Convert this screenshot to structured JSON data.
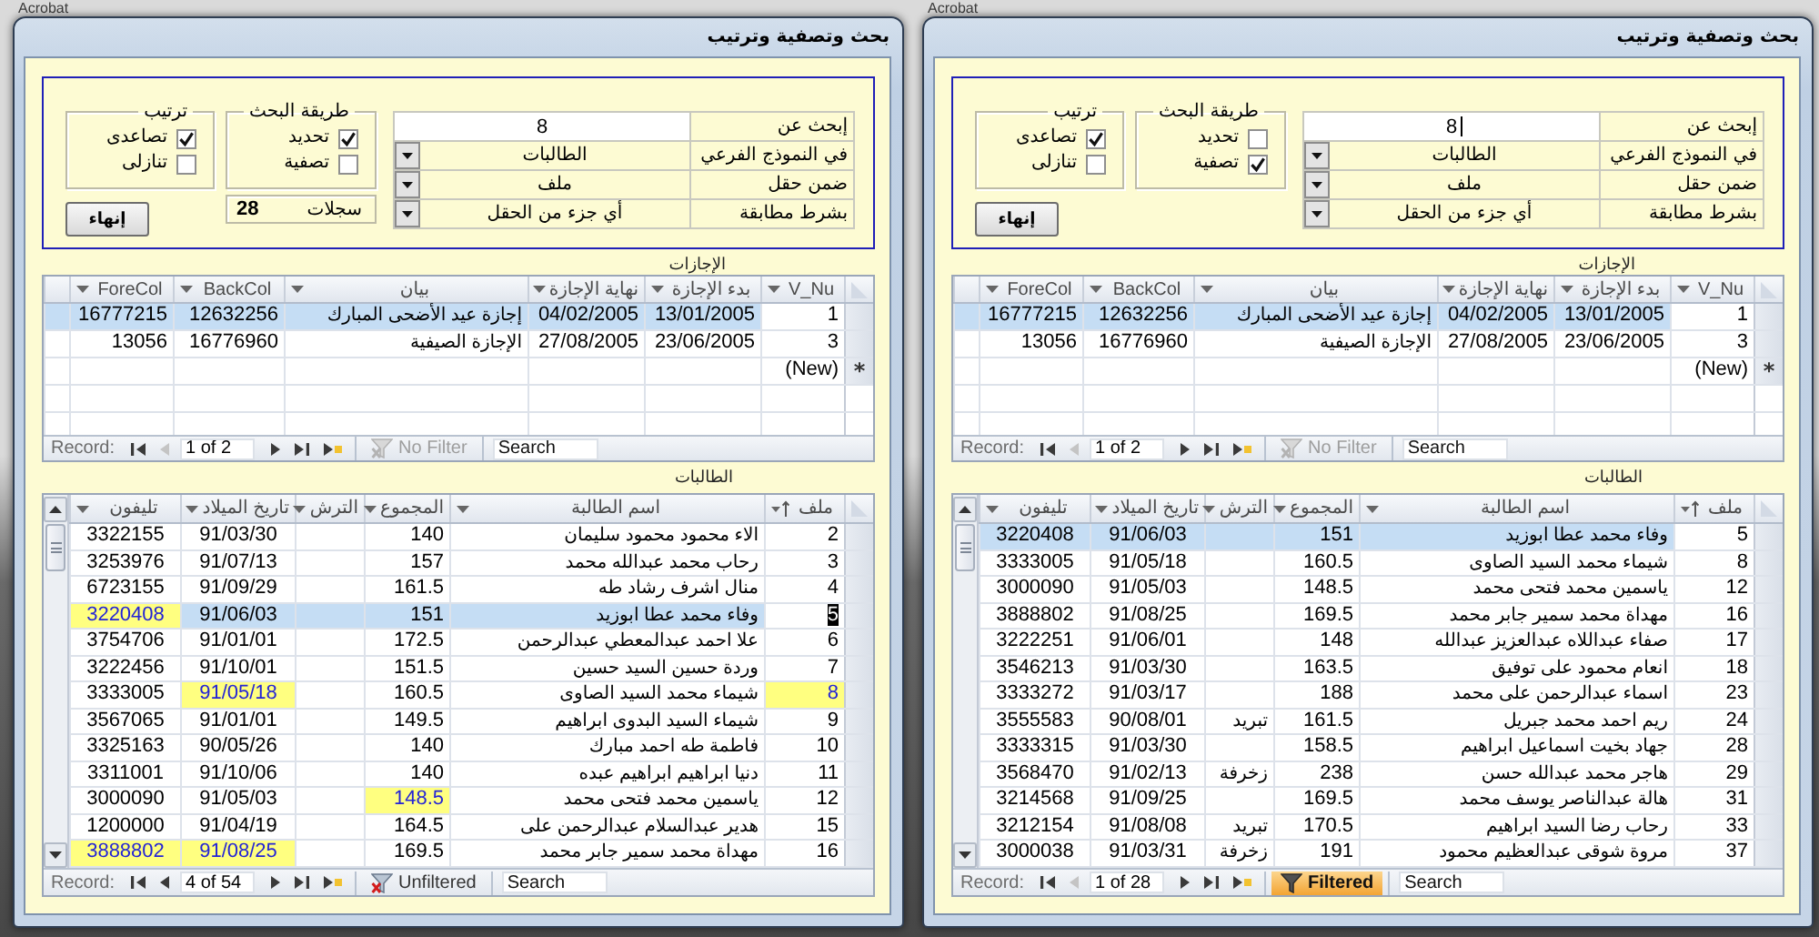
{
  "screens": [
    {
      "background_app": {
        "title": "Acrobat"
      },
      "window": {
        "title": "بحث وتصفية وترتيب"
      },
      "search_panel": {
        "fields": [
          {
            "kind": "text",
            "label": "إبحث عن",
            "value": "8",
            "focused": true
          },
          {
            "kind": "dropdown",
            "label": "في النموذج الفرعي",
            "value": "الطالبات"
          },
          {
            "kind": "dropdown",
            "label": "ضمن حقل",
            "value": "ملف"
          },
          {
            "kind": "dropdown",
            "label": "بشرط مطابقة",
            "value": "أي جزء من الحقل"
          }
        ],
        "search_method": {
          "title": "طريقة البحث",
          "options": [
            {
              "label": "تحديد",
              "checked": false
            },
            {
              "label": "تصفية",
              "checked": true
            }
          ]
        },
        "sort_order": {
          "title": "ترتيب",
          "options": [
            {
              "label": "تصاعدى",
              "checked": true
            },
            {
              "label": "تنازلى",
              "checked": false
            }
          ]
        },
        "close_button": {
          "label": "إنهاء"
        }
      },
      "leaves": {
        "title": "الإجازات",
        "columns": [
          "V_Nu",
          "بدء الإجازة",
          "نهاية الإجازة",
          "بيان",
          "BackCol",
          "ForeCol"
        ],
        "rows": [
          {
            "selected": true,
            "cells": [
              "1",
              "13/01/2005",
              "04/02/2005",
              "إجازة عيد الأضحى المبارك",
              "12632256",
              "16777215"
            ]
          },
          {
            "selected": false,
            "cells": [
              "3",
              "23/06/2005",
              "27/08/2005",
              "الإجازة الصيفية",
              "16776960",
              "13056"
            ]
          }
        ],
        "new_row": {
          "marker": "*",
          "text": "(New)"
        },
        "navigation": {
          "label": "Record:",
          "position": "1 of 2",
          "previous_enabled": false,
          "filter": {
            "label": "No Filter",
            "disabled": true,
            "active": false
          },
          "search": {
            "placeholder": "Search"
          }
        }
      },
      "students": {
        "title": "الطالبات",
        "columns": [
          {
            "label": "ملف",
            "sorted": true
          },
          {
            "label": "اسم الطالبة",
            "sorted": false
          },
          {
            "label": "المجموع",
            "sorted": false
          },
          {
            "label": "الترش",
            "sorted": false
          },
          {
            "label": "تاريخ الميلاد",
            "sorted": false
          },
          {
            "label": "تليفون",
            "sorted": false
          }
        ],
        "rows": [
          {
            "selected": true,
            "editing": false,
            "cells": [
              {
                "text": "5",
                "highlighted": false
              },
              {
                "text": "وفاء محمد عطا ابوزيد",
                "highlighted": false
              },
              {
                "text": "151",
                "highlighted": false
              },
              {
                "highlighted": false
              },
              {
                "text": "91/06/03",
                "highlighted": false
              },
              {
                "text": "3220408",
                "highlighted": false
              }
            ]
          },
          {
            "selected": false,
            "editing": false,
            "cells": [
              {
                "text": "8",
                "highlighted": false
              },
              {
                "text": "شيماء محمد السيد الصاوى",
                "highlighted": false
              },
              {
                "text": "160.5",
                "highlighted": false
              },
              {
                "highlighted": false
              },
              {
                "text": "91/05/18",
                "highlighted": false
              },
              {
                "text": "3333005",
                "highlighted": false
              }
            ]
          },
          {
            "selected": false,
            "editing": false,
            "cells": [
              {
                "text": "12",
                "highlighted": false
              },
              {
                "text": "ياسمين محمد فتحى محمد",
                "highlighted": false
              },
              {
                "text": "148.5",
                "highlighted": false
              },
              {
                "highlighted": false
              },
              {
                "text": "91/05/03",
                "highlighted": false
              },
              {
                "text": "3000090",
                "highlighted": false
              }
            ]
          },
          {
            "selected": false,
            "editing": false,
            "cells": [
              {
                "text": "16",
                "highlighted": false
              },
              {
                "text": "مهداة محمد سمير جابر محمد",
                "highlighted": false
              },
              {
                "text": "169.5",
                "highlighted": false
              },
              {
                "highlighted": false
              },
              {
                "text": "91/08/25",
                "highlighted": false
              },
              {
                "text": "3888802",
                "highlighted": false
              }
            ]
          },
          {
            "selected": false,
            "editing": false,
            "cells": [
              {
                "text": "17",
                "highlighted": false
              },
              {
                "text": "صفاء عبداللاه عبدالعزيز عبدالله",
                "highlighted": false
              },
              {
                "text": "148",
                "highlighted": false
              },
              {
                "highlighted": false
              },
              {
                "text": "91/06/01",
                "highlighted": false
              },
              {
                "text": "3222251",
                "highlighted": false
              }
            ]
          },
          {
            "selected": false,
            "editing": false,
            "cells": [
              {
                "text": "18",
                "highlighted": false
              },
              {
                "text": "انعام محمود على توفيق",
                "highlighted": false
              },
              {
                "text": "163.5",
                "highlighted": false
              },
              {
                "highlighted": false
              },
              {
                "text": "91/03/30",
                "highlighted": false
              },
              {
                "text": "3546213",
                "highlighted": false
              }
            ]
          },
          {
            "selected": false,
            "editing": false,
            "cells": [
              {
                "text": "23",
                "highlighted": false
              },
              {
                "text": "اسماء عبدالرحمن على محمد",
                "highlighted": false
              },
              {
                "text": "188",
                "highlighted": false
              },
              {
                "highlighted": false
              },
              {
                "text": "91/03/17",
                "highlighted": false
              },
              {
                "text": "3333272",
                "highlighted": false
              }
            ]
          },
          {
            "selected": false,
            "editing": false,
            "cells": [
              {
                "text": "24",
                "highlighted": false
              },
              {
                "text": "ريم احمد محمد جبريل",
                "highlighted": false
              },
              {
                "text": "161.5",
                "highlighted": false
              },
              {
                "text": "تبريد",
                "highlighted": false
              },
              {
                "text": "90/08/01",
                "highlighted": false
              },
              {
                "text": "3555583",
                "highlighted": false
              }
            ]
          },
          {
            "selected": false,
            "editing": false,
            "cells": [
              {
                "text": "28",
                "highlighted": false
              },
              {
                "text": "جهاد بخيت اسماعيل ابراهيم",
                "highlighted": false
              },
              {
                "text": "158.5",
                "highlighted": false
              },
              {
                "highlighted": false
              },
              {
                "text": "91/03/30",
                "highlighted": false
              },
              {
                "text": "3333315",
                "highlighted": false
              }
            ]
          },
          {
            "selected": false,
            "editing": false,
            "cells": [
              {
                "text": "29",
                "highlighted": false
              },
              {
                "text": "هاجر محمد عبدالله حسن",
                "highlighted": false
              },
              {
                "text": "238",
                "highlighted": false
              },
              {
                "text": "زخرفة",
                "highlighted": false
              },
              {
                "text": "91/02/13",
                "highlighted": false
              },
              {
                "text": "3568470",
                "highlighted": false
              }
            ]
          },
          {
            "selected": false,
            "editing": false,
            "cells": [
              {
                "text": "31",
                "highlighted": false
              },
              {
                "text": "هالة عبدالناصر يوسف محمد",
                "highlighted": false
              },
              {
                "text": "169.5",
                "highlighted": false
              },
              {
                "highlighted": false
              },
              {
                "text": "91/09/25",
                "highlighted": false
              },
              {
                "text": "3214568",
                "highlighted": false
              }
            ]
          },
          {
            "selected": false,
            "editing": false,
            "cells": [
              {
                "text": "33",
                "highlighted": false
              },
              {
                "text": "رحاب رضا السيد ابراهيم",
                "highlighted": false
              },
              {
                "text": "170.5",
                "highlighted": false
              },
              {
                "text": "تبريد",
                "highlighted": false
              },
              {
                "text": "91/08/08",
                "highlighted": false
              },
              {
                "text": "3212154",
                "highlighted": false
              }
            ]
          },
          {
            "selected": false,
            "editing": false,
            "cells": [
              {
                "text": "37",
                "highlighted": false
              },
              {
                "text": "مروة شوقى عبدالعظيم محمود",
                "highlighted": false
              },
              {
                "text": "191",
                "highlighted": false
              },
              {
                "text": "زخرفة",
                "highlighted": false
              },
              {
                "text": "91/03/31",
                "highlighted": false
              },
              {
                "text": "3000038",
                "highlighted": false
              }
            ]
          }
        ],
        "navigation": {
          "label": "Record:",
          "position": "1 of 28",
          "previous_enabled": false,
          "filter": {
            "label": "Filtered",
            "disabled": false,
            "active": true
          },
          "search": {
            "placeholder": "Search"
          }
        }
      }
    },
    {
      "background_app": {
        "title": "Acrobat"
      },
      "window": {
        "title": "بحث وتصفية وترتيب"
      },
      "search_panel": {
        "fields": [
          {
            "kind": "text",
            "label": "إبحث عن",
            "value": "8",
            "focused": false
          },
          {
            "kind": "dropdown",
            "label": "في النموذج الفرعي",
            "value": "الطالبات"
          },
          {
            "kind": "dropdown",
            "label": "ضمن حقل",
            "value": "ملف"
          },
          {
            "kind": "dropdown",
            "label": "بشرط مطابقة",
            "value": "أي جزء من الحقل"
          }
        ],
        "search_method": {
          "title": "طريقة البحث",
          "options": [
            {
              "label": "تحديد",
              "checked": true
            },
            {
              "label": "تصفية",
              "checked": false
            }
          ]
        },
        "records": {
          "label": "سجلات",
          "count": "28"
        },
        "sort_order": {
          "title": "ترتيب",
          "options": [
            {
              "label": "تصاعدى",
              "checked": true
            },
            {
              "label": "تنازلى",
              "checked": false
            }
          ]
        },
        "close_button": {
          "label": "إنهاء"
        }
      },
      "leaves": {
        "title": "الإجازات",
        "columns": [
          "V_Nu",
          "بدء الإجازة",
          "نهاية الإجازة",
          "بيان",
          "BackCol",
          "ForeCol"
        ],
        "rows": [
          {
            "selected": true,
            "cells": [
              "1",
              "13/01/2005",
              "04/02/2005",
              "إجازة عيد الأضحى المبارك",
              "12632256",
              "16777215"
            ]
          },
          {
            "selected": false,
            "cells": [
              "3",
              "23/06/2005",
              "27/08/2005",
              "الإجازة الصيفية",
              "16776960",
              "13056"
            ]
          }
        ],
        "new_row": {
          "marker": "*",
          "text": "(New)"
        },
        "navigation": {
          "label": "Record:",
          "position": "1 of 2",
          "previous_enabled": false,
          "filter": {
            "label": "No Filter",
            "disabled": true,
            "active": false
          },
          "search": {
            "placeholder": "Search"
          }
        }
      },
      "students": {
        "title": "الطالبات",
        "columns": [
          {
            "label": "ملف",
            "sorted": true
          },
          {
            "label": "اسم الطالبة",
            "sorted": false
          },
          {
            "label": "المجموع",
            "sorted": false
          },
          {
            "label": "الترش",
            "sorted": false
          },
          {
            "label": "تاريخ الميلاد",
            "sorted": false
          },
          {
            "label": "تليفون",
            "sorted": false
          }
        ],
        "rows": [
          {
            "selected": false,
            "editing": false,
            "cells": [
              {
                "text": "2",
                "highlighted": false
              },
              {
                "text": "الاء محمود محمود سليمان",
                "highlighted": false
              },
              {
                "text": "140",
                "highlighted": false
              },
              {
                "highlighted": false
              },
              {
                "text": "91/03/30",
                "highlighted": false
              },
              {
                "text": "3322155",
                "highlighted": false
              }
            ]
          },
          {
            "selected": false,
            "editing": false,
            "cells": [
              {
                "text": "3",
                "highlighted": false
              },
              {
                "text": "رحاب محمد عبدالله محمد",
                "highlighted": false
              },
              {
                "text": "157",
                "highlighted": false
              },
              {
                "highlighted": false
              },
              {
                "text": "91/07/13",
                "highlighted": false
              },
              {
                "text": "3253976",
                "highlighted": false
              }
            ]
          },
          {
            "selected": false,
            "editing": false,
            "cells": [
              {
                "text": "4",
                "highlighted": false
              },
              {
                "text": "منال اشرف رشاد طه",
                "highlighted": false
              },
              {
                "text": "161.5",
                "highlighted": false
              },
              {
                "highlighted": false
              },
              {
                "text": "91/09/29",
                "highlighted": false
              },
              {
                "text": "6723155",
                "highlighted": false
              }
            ]
          },
          {
            "selected": true,
            "editing": true,
            "cells": [
              {
                "text": "5",
                "highlighted": false
              },
              {
                "text": "وفاء محمد عطا ابوزيد",
                "highlighted": false
              },
              {
                "text": "151",
                "highlighted": false
              },
              {
                "highlighted": false
              },
              {
                "text": "91/06/03",
                "highlighted": false
              },
              {
                "text": "3220408",
                "highlighted": true
              }
            ]
          },
          {
            "selected": false,
            "editing": false,
            "cells": [
              {
                "text": "6",
                "highlighted": false
              },
              {
                "text": "علا احمد عبدالمعطي عبدالرحمن",
                "highlighted": false
              },
              {
                "text": "172.5",
                "highlighted": false
              },
              {
                "highlighted": false
              },
              {
                "text": "91/01/01",
                "highlighted": false
              },
              {
                "text": "3754706",
                "highlighted": false
              }
            ]
          },
          {
            "selected": false,
            "editing": false,
            "cells": [
              {
                "text": "7",
                "highlighted": false
              },
              {
                "text": "وردة حسين السيد حسين",
                "highlighted": false
              },
              {
                "text": "151.5",
                "highlighted": false
              },
              {
                "highlighted": false
              },
              {
                "text": "91/10/01",
                "highlighted": false
              },
              {
                "text": "3222456",
                "highlighted": false
              }
            ]
          },
          {
            "selected": false,
            "editing": false,
            "cells": [
              {
                "text": "8",
                "highlighted": true
              },
              {
                "text": "شيماء محمد السيد الصاوى",
                "highlighted": false
              },
              {
                "text": "160.5",
                "highlighted": false
              },
              {
                "highlighted": false
              },
              {
                "text": "91/05/18",
                "highlighted": true
              },
              {
                "text": "3333005",
                "highlighted": false
              }
            ]
          },
          {
            "selected": false,
            "editing": false,
            "cells": [
              {
                "text": "9",
                "highlighted": false
              },
              {
                "text": "شيماء السيد البدوى ابراهيم",
                "highlighted": false
              },
              {
                "text": "149.5",
                "highlighted": false
              },
              {
                "highlighted": false
              },
              {
                "text": "91/01/01",
                "highlighted": false
              },
              {
                "text": "3567065",
                "highlighted": false
              }
            ]
          },
          {
            "selected": false,
            "editing": false,
            "cells": [
              {
                "text": "10",
                "highlighted": false
              },
              {
                "text": "فاطمة طه احمد مبارك",
                "highlighted": false
              },
              {
                "text": "140",
                "highlighted": false
              },
              {
                "highlighted": false
              },
              {
                "text": "90/05/26",
                "highlighted": false
              },
              {
                "text": "3325163",
                "highlighted": false
              }
            ]
          },
          {
            "selected": false,
            "editing": false,
            "cells": [
              {
                "text": "11",
                "highlighted": false
              },
              {
                "text": "دنيا ابراهيم ابراهيم عبده",
                "highlighted": false
              },
              {
                "text": "140",
                "highlighted": false
              },
              {
                "highlighted": false
              },
              {
                "text": "91/10/06",
                "highlighted": false
              },
              {
                "text": "3311001",
                "highlighted": false
              }
            ]
          },
          {
            "selected": false,
            "editing": false,
            "cells": [
              {
                "text": "12",
                "highlighted": false
              },
              {
                "text": "ياسمين محمد فتحى محمد",
                "highlighted": false
              },
              {
                "text": "148.5",
                "highlighted": true
              },
              {
                "highlighted": false
              },
              {
                "text": "91/05/03",
                "highlighted": false
              },
              {
                "text": "3000090",
                "highlighted": false
              }
            ]
          },
          {
            "selected": false,
            "editing": false,
            "cells": [
              {
                "text": "15",
                "highlighted": false
              },
              {
                "text": "هدير عبدالسلام عبدالرحمن على",
                "highlighted": false
              },
              {
                "text": "164.5",
                "highlighted": false
              },
              {
                "highlighted": false
              },
              {
                "text": "91/04/19",
                "highlighted": false
              },
              {
                "text": "1200000",
                "highlighted": false
              }
            ]
          },
          {
            "selected": false,
            "editing": false,
            "cells": [
              {
                "text": "16",
                "highlighted": false
              },
              {
                "text": "مهداة محمد سمير جابر محمد",
                "highlighted": false
              },
              {
                "text": "169.5",
                "highlighted": false
              },
              {
                "highlighted": false
              },
              {
                "text": "91/08/25",
                "highlighted": true
              },
              {
                "text": "3888802",
                "highlighted": true
              }
            ]
          }
        ],
        "navigation": {
          "label": "Record:",
          "position": "4 of 54",
          "previous_enabled": true,
          "filter": {
            "label": "Unfiltered",
            "disabled": false,
            "active": false
          },
          "search": {
            "placeholder": "Search"
          }
        }
      }
    }
  ]
}
